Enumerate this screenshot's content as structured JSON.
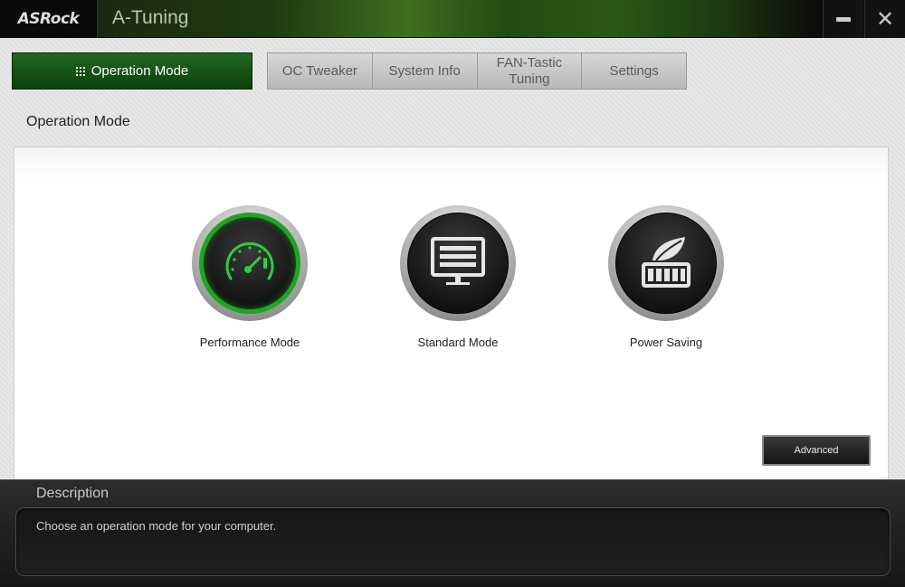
{
  "window": {
    "brand": "ASRock",
    "title": "A-Tuning",
    "minimize_icon": "minimize-icon",
    "close_icon": "close-icon"
  },
  "tabs": {
    "active": {
      "label": "Operation Mode",
      "icon": "grid-icon"
    },
    "items": [
      {
        "label": "OC Tweaker"
      },
      {
        "label": "System Info"
      },
      {
        "label": "FAN-Tastic Tuning"
      },
      {
        "label": "Settings"
      }
    ]
  },
  "section": {
    "title": "Operation Mode"
  },
  "modes": [
    {
      "label": "Performance Mode",
      "icon": "speedometer-icon",
      "active": true
    },
    {
      "label": "Standard Mode",
      "icon": "monitor-icon",
      "active": false
    },
    {
      "label": "Power Saving",
      "icon": "leaf-battery-icon",
      "active": false
    }
  ],
  "advanced": {
    "label": "Advanced"
  },
  "description": {
    "title": "Description",
    "text": "Choose an operation mode for your computer."
  },
  "colors": {
    "accent_green": "#1fa51f",
    "active_tab": "#155515",
    "bottom_bg": "#1e1e1e"
  }
}
